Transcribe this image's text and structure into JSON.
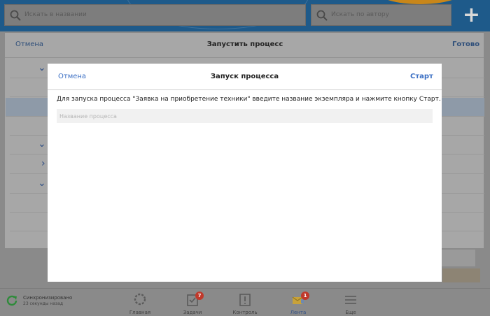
{
  "header": {
    "search_title_placeholder": "Искать в названии",
    "search_author_placeholder": "Искать по автору",
    "add_icon": "plus-icon"
  },
  "sheet": {
    "cancel_label": "Отмена",
    "title": "Запустить процесс",
    "done_label": "Готово"
  },
  "modal": {
    "cancel_label": "Отмена",
    "title": "Запуск процесса",
    "start_label": "Старт",
    "description": "Для запуска процесса \"Заявка на приобретение техники\" введите название экземпляра и нажмите кнопку Старт.",
    "input_placeholder": "Название процесса",
    "input_value": ""
  },
  "status": {
    "sync_title": "Синхронизировано",
    "sync_subtitle": "23 секунды назад"
  },
  "tabs": [
    {
      "label": "Главная",
      "icon": "home-icon",
      "badge": ""
    },
    {
      "label": "Задачи",
      "icon": "tasks-icon",
      "badge": "7"
    },
    {
      "label": "Контроль",
      "icon": "control-icon",
      "badge": ""
    },
    {
      "label": "Лента",
      "icon": "feed-icon",
      "badge": "1"
    },
    {
      "label": "Еще",
      "icon": "menu-icon",
      "badge": ""
    }
  ],
  "colors": {
    "accent": "#3b6fc4",
    "header_bg": "#1e5a8a",
    "badge": "#c0392b"
  }
}
